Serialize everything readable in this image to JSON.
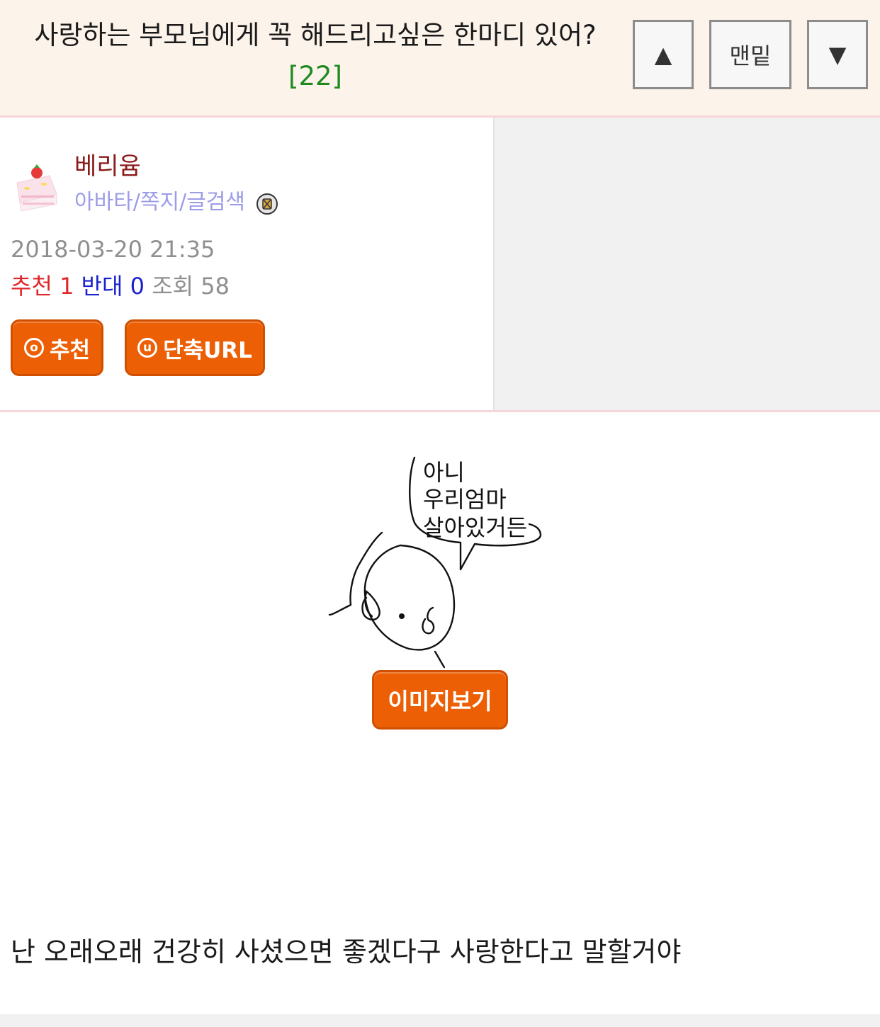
{
  "header": {
    "title": "사랑하는 부모님에게 꼭 해드리고싶은 한마디 있어?",
    "comment_count": "[22]",
    "nav_up": "▲",
    "nav_bottom": "맨밑",
    "nav_down": "▼"
  },
  "post": {
    "author": "베리윰",
    "profile_links": "아바타/쪽지/글검색",
    "date": "2018-03-20 21:35",
    "recommend_label": "추천",
    "recommend_count": "1",
    "oppose_label": "반대",
    "oppose_count": "0",
    "views_label": "조회",
    "views_count": "58",
    "recommend_button": "추천",
    "short_url_button": "단축URL"
  },
  "image": {
    "speech_lines": [
      "아니",
      "우리엄마",
      "살아있거든"
    ],
    "view_button": "이미지보기"
  },
  "content": {
    "text": "난 오래오래 건강히 사셨으면 좋겠다구 사랑한다고 말할거야"
  },
  "colors": {
    "header_bg": "#fcf3eb",
    "accent_orange": "#ec5f05",
    "author": "#8b1a1a",
    "recommend": "#e0262a",
    "oppose": "#1a23cc",
    "comment_count": "#1e8a1e"
  }
}
